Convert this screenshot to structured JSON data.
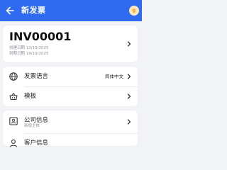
{
  "appbar": {
    "title": "新发票",
    "back_icon": "back-arrow-icon",
    "premium_icon": "premium-diamond-icon",
    "color": "#2f6bf0"
  },
  "invoice": {
    "number": "INV00001",
    "created": "创建日期 12/10/2025",
    "due": "到期日期 19/10/2025"
  },
  "settings": {
    "language_label": "发票语言",
    "language_value": "简体中文",
    "language_icon": "globe-icon",
    "template_label": "模板",
    "template_icon": "basket-icon"
  },
  "company": {
    "label": "公司信息",
    "sub": "新增主体",
    "icon": "id-card-icon"
  },
  "client": {
    "label": "客户信息",
    "icon": "person-icon"
  }
}
